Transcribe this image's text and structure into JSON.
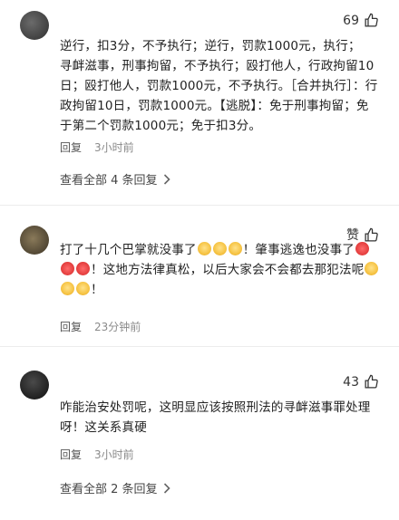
{
  "comments": [
    {
      "likes": "69",
      "text": "逆行，扣3分，不予执行；逆行，罚款1000元，执行；\n寻衅滋事，刑事拘留，不予执行；殴打他人，行政拘留10日；殴打他人，罚款1000元，不予执行。［合并执行］：行政拘留10日，罚款1000元。【逃脱】：免于刑事拘留；免于第二个罚款1000元；免于扣3分。",
      "reply_label": "回复",
      "time": "3小时前",
      "more_replies": "查看全部 4 条回复"
    },
    {
      "likes": "赞",
      "text_parts": {
        "p1": "打了十几个巴掌就没事了",
        "p2": "！肇事逃逸也没事了",
        "p3": "！这地方法律真松，以后大家会不会都去那犯法呢",
        "p4": "！"
      },
      "reply_label": "回复",
      "time": "23分钟前"
    },
    {
      "likes": "43",
      "text": "咋能治安处罚呢，这明显应该按照刑法的寻衅滋事罪处理呀！这关系真硬",
      "reply_label": "回复",
      "time": "3小时前",
      "more_replies": "查看全部 2 条回复"
    }
  ],
  "icons": {
    "like": "thumbs-up-icon",
    "chevron": "chevron-right-icon"
  },
  "colors": {
    "meta": "#8a8a8a",
    "text": "#222222"
  }
}
